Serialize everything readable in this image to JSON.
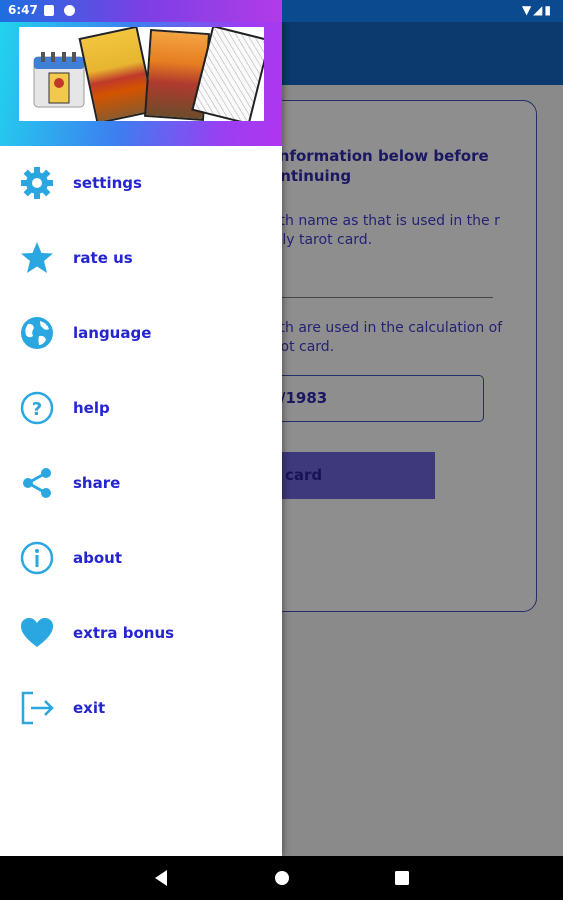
{
  "status_bar": {
    "time": "6:47"
  },
  "background_screen": {
    "heading": "r information below before continuing",
    "name_help_text": "birth name as that is used in the r daily tarot card.",
    "date_help_text": "birth are used in the calculation of tarot card.",
    "date_value": "/1983",
    "button_label": "card"
  },
  "drawer": {
    "items": [
      {
        "label": "settings",
        "icon": "gear-icon"
      },
      {
        "label": "rate us",
        "icon": "star-icon"
      },
      {
        "label": "language",
        "icon": "globe-icon"
      },
      {
        "label": "help",
        "icon": "help-circle-icon"
      },
      {
        "label": "share",
        "icon": "share-icon"
      },
      {
        "label": "about",
        "icon": "info-icon"
      },
      {
        "label": "extra bonus",
        "icon": "heart-icon"
      },
      {
        "label": "exit",
        "icon": "exit-icon"
      }
    ]
  },
  "colors": {
    "icon_blue": "#2aa7e0",
    "label_blue": "#2525d0",
    "app_bar": "#1565c0"
  }
}
